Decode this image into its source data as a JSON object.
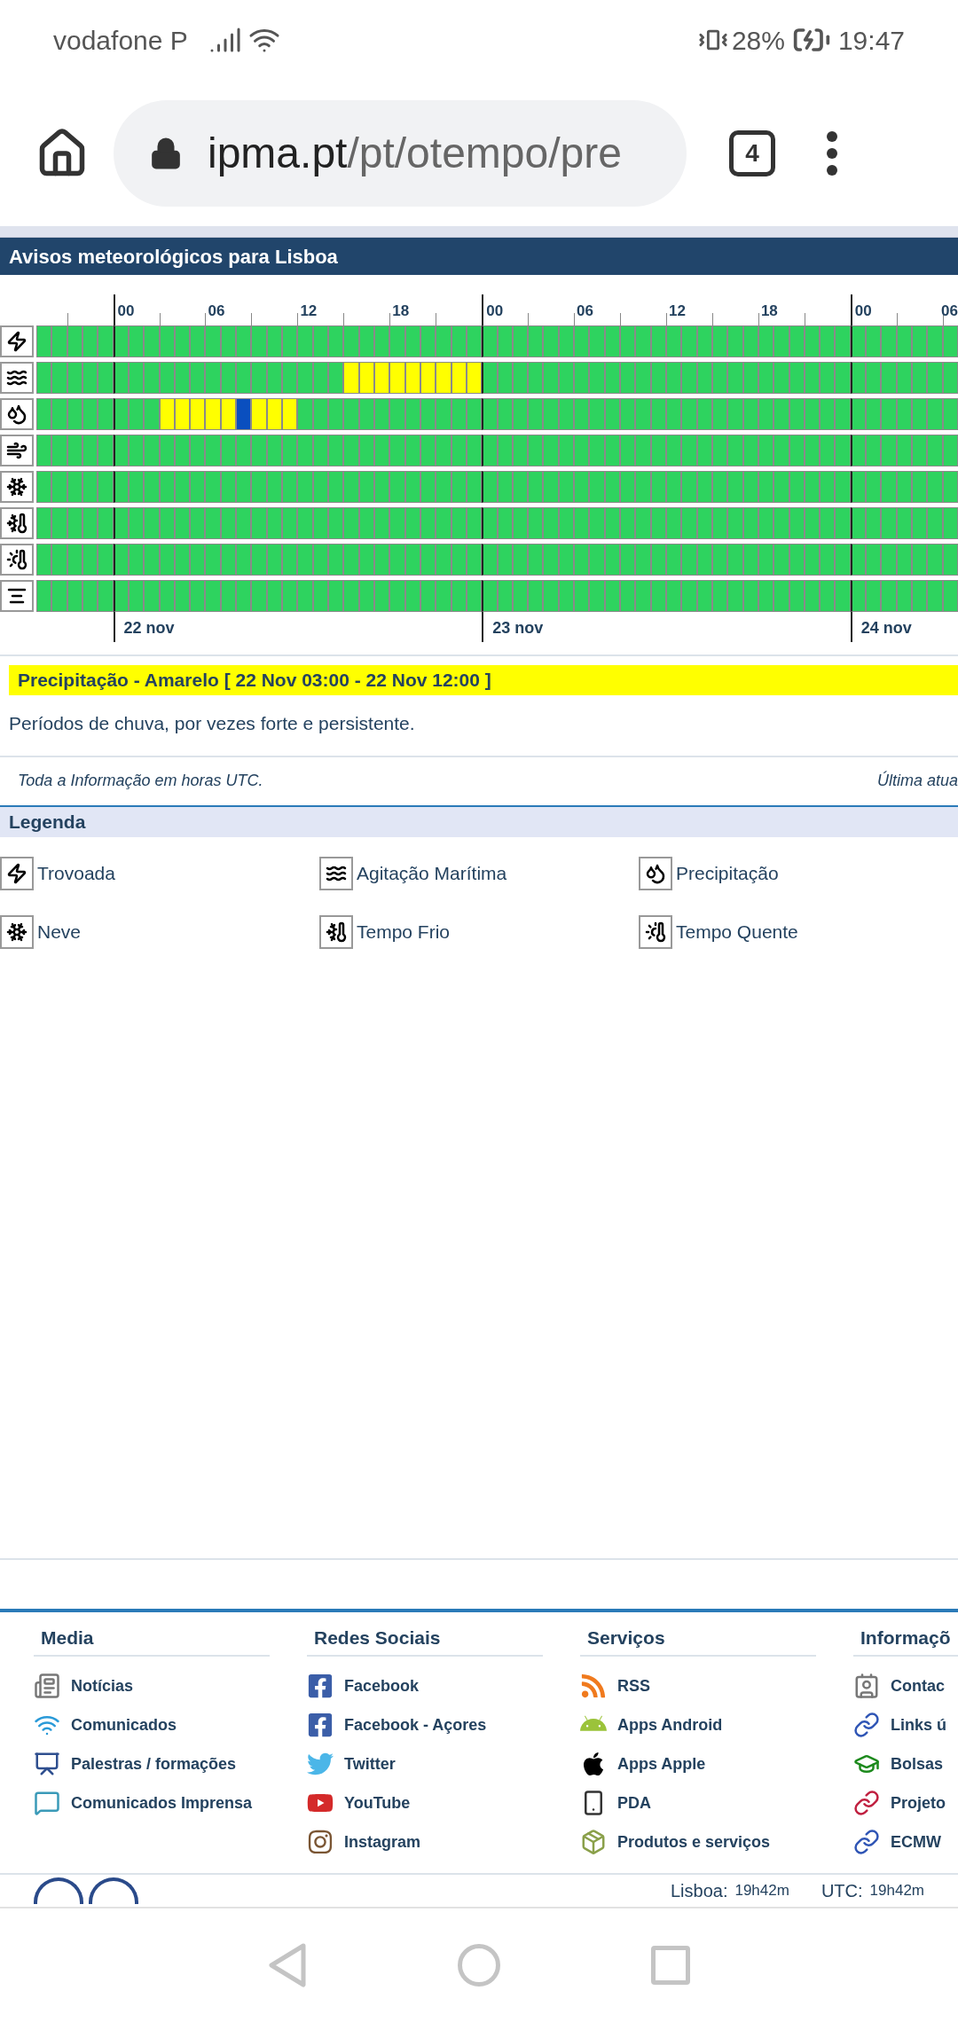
{
  "status_bar": {
    "carrier": "vodafone P",
    "battery": "28%",
    "time": "19:47"
  },
  "browser": {
    "url_host": "ipma.pt",
    "url_path": "/pt/otempo/pre",
    "tab_count": "4"
  },
  "panel": {
    "title": "Avisos meteorológicos para Lisboa",
    "hour_labels": [
      "00",
      "06",
      "12",
      "18",
      "00",
      "06",
      "12",
      "18",
      "00",
      "06"
    ],
    "day_labels": [
      "22 nov",
      "23 nov",
      "24 nov"
    ],
    "rows": [
      {
        "kind": "thunder",
        "cells": [
          {
            "color": "#2ed35f"
          },
          {
            "color": "#2ed35f"
          },
          {
            "color": "#2ed35f"
          },
          {
            "color": "#2ed35f"
          },
          {
            "color": "#2ed35f"
          },
          {
            "color": "#2ed35f"
          },
          {
            "color": "#2ed35f"
          },
          {
            "color": "#2ed35f"
          },
          {
            "color": "#2ed35f"
          },
          {
            "color": "#2ed35f"
          },
          {
            "color": "#2ed35f"
          },
          {
            "color": "#2ed35f"
          },
          {
            "color": "#2ed35f"
          },
          {
            "color": "#2ed35f"
          },
          {
            "color": "#2ed35f"
          },
          {
            "color": "#2ed35f"
          },
          {
            "color": "#2ed35f"
          },
          {
            "color": "#2ed35f"
          },
          {
            "color": "#2ed35f"
          },
          {
            "color": "#2ed35f"
          },
          {
            "color": "#2ed35f"
          },
          {
            "color": "#2ed35f"
          },
          {
            "color": "#2ed35f"
          },
          {
            "color": "#2ed35f"
          },
          {
            "color": "#2ed35f"
          },
          {
            "color": "#2ed35f"
          },
          {
            "color": "#2ed35f"
          },
          {
            "color": "#2ed35f"
          },
          {
            "color": "#2ed35f"
          },
          {
            "color": "#2ed35f"
          },
          {
            "color": "#2ed35f"
          },
          {
            "color": "#2ed35f"
          },
          {
            "color": "#2ed35f"
          },
          {
            "color": "#2ed35f"
          },
          {
            "color": "#2ed35f"
          },
          {
            "color": "#2ed35f"
          },
          {
            "color": "#2ed35f"
          },
          {
            "color": "#2ed35f"
          },
          {
            "color": "#2ed35f"
          },
          {
            "color": "#2ed35f"
          },
          {
            "color": "#2ed35f"
          },
          {
            "color": "#2ed35f"
          },
          {
            "color": "#2ed35f"
          },
          {
            "color": "#2ed35f"
          },
          {
            "color": "#2ed35f"
          },
          {
            "color": "#2ed35f"
          },
          {
            "color": "#2ed35f"
          },
          {
            "color": "#2ed35f"
          },
          {
            "color": "#2ed35f"
          },
          {
            "color": "#2ed35f"
          },
          {
            "color": "#2ed35f"
          },
          {
            "color": "#2ed35f"
          },
          {
            "color": "#2ed35f"
          },
          {
            "color": "#2ed35f"
          },
          {
            "color": "#2ed35f"
          },
          {
            "color": "#2ed35f"
          },
          {
            "color": "#2ed35f"
          },
          {
            "color": "#2ed35f"
          },
          {
            "color": "#2ed35f"
          },
          {
            "color": "#2ed35f"
          }
        ]
      },
      {
        "kind": "sea",
        "cells": [
          {
            "color": "#2ed35f"
          },
          {
            "color": "#2ed35f"
          },
          {
            "color": "#2ed35f"
          },
          {
            "color": "#2ed35f"
          },
          {
            "color": "#2ed35f"
          },
          {
            "color": "#2ed35f"
          },
          {
            "color": "#2ed35f"
          },
          {
            "color": "#2ed35f"
          },
          {
            "color": "#2ed35f"
          },
          {
            "color": "#2ed35f"
          },
          {
            "color": "#2ed35f"
          },
          {
            "color": "#2ed35f"
          },
          {
            "color": "#2ed35f"
          },
          {
            "color": "#2ed35f"
          },
          {
            "color": "#2ed35f"
          },
          {
            "color": "#2ed35f"
          },
          {
            "color": "#2ed35f"
          },
          {
            "color": "#2ed35f"
          },
          {
            "color": "#2ed35f"
          },
          {
            "color": "#2ed35f"
          },
          {
            "color": "#ffff00"
          },
          {
            "color": "#ffff00"
          },
          {
            "color": "#ffff00"
          },
          {
            "color": "#ffff00"
          },
          {
            "color": "#ffff00"
          },
          {
            "color": "#ffff00"
          },
          {
            "color": "#ffff00"
          },
          {
            "color": "#ffff00"
          },
          {
            "color": "#ffff00"
          },
          {
            "color": "#2ed35f"
          },
          {
            "color": "#2ed35f"
          },
          {
            "color": "#2ed35f"
          },
          {
            "color": "#2ed35f"
          },
          {
            "color": "#2ed35f"
          },
          {
            "color": "#2ed35f"
          },
          {
            "color": "#2ed35f"
          },
          {
            "color": "#2ed35f"
          },
          {
            "color": "#2ed35f"
          },
          {
            "color": "#2ed35f"
          },
          {
            "color": "#2ed35f"
          },
          {
            "color": "#2ed35f"
          },
          {
            "color": "#2ed35f"
          },
          {
            "color": "#2ed35f"
          },
          {
            "color": "#2ed35f"
          },
          {
            "color": "#2ed35f"
          },
          {
            "color": "#2ed35f"
          },
          {
            "color": "#2ed35f"
          },
          {
            "color": "#2ed35f"
          },
          {
            "color": "#2ed35f"
          },
          {
            "color": "#2ed35f"
          },
          {
            "color": "#2ed35f"
          },
          {
            "color": "#2ed35f"
          },
          {
            "color": "#2ed35f"
          },
          {
            "color": "#2ed35f"
          },
          {
            "color": "#2ed35f"
          },
          {
            "color": "#2ed35f"
          },
          {
            "color": "#2ed35f"
          },
          {
            "color": "#2ed35f"
          },
          {
            "color": "#2ed35f"
          },
          {
            "color": "#2ed35f"
          }
        ]
      },
      {
        "kind": "rain",
        "cells": [
          {
            "color": "#2ed35f"
          },
          {
            "color": "#2ed35f"
          },
          {
            "color": "#2ed35f"
          },
          {
            "color": "#2ed35f"
          },
          {
            "color": "#2ed35f"
          },
          {
            "color": "#2ed35f"
          },
          {
            "color": "#2ed35f"
          },
          {
            "color": "#2ed35f"
          },
          {
            "color": "#ffff00"
          },
          {
            "color": "#ffff00"
          },
          {
            "color": "#ffff00"
          },
          {
            "color": "#ffff00"
          },
          {
            "color": "#ffff00"
          },
          {
            "color": "#0a4fbf"
          },
          {
            "color": "#ffff00"
          },
          {
            "color": "#ffff00"
          },
          {
            "color": "#ffff00"
          },
          {
            "color": "#2ed35f"
          },
          {
            "color": "#2ed35f"
          },
          {
            "color": "#2ed35f"
          },
          {
            "color": "#2ed35f"
          },
          {
            "color": "#2ed35f"
          },
          {
            "color": "#2ed35f"
          },
          {
            "color": "#2ed35f"
          },
          {
            "color": "#2ed35f"
          },
          {
            "color": "#2ed35f"
          },
          {
            "color": "#2ed35f"
          },
          {
            "color": "#2ed35f"
          },
          {
            "color": "#2ed35f"
          },
          {
            "color": "#2ed35f"
          },
          {
            "color": "#2ed35f"
          },
          {
            "color": "#2ed35f"
          },
          {
            "color": "#2ed35f"
          },
          {
            "color": "#2ed35f"
          },
          {
            "color": "#2ed35f"
          },
          {
            "color": "#2ed35f"
          },
          {
            "color": "#2ed35f"
          },
          {
            "color": "#2ed35f"
          },
          {
            "color": "#2ed35f"
          },
          {
            "color": "#2ed35f"
          },
          {
            "color": "#2ed35f"
          },
          {
            "color": "#2ed35f"
          },
          {
            "color": "#2ed35f"
          },
          {
            "color": "#2ed35f"
          },
          {
            "color": "#2ed35f"
          },
          {
            "color": "#2ed35f"
          },
          {
            "color": "#2ed35f"
          },
          {
            "color": "#2ed35f"
          },
          {
            "color": "#2ed35f"
          },
          {
            "color": "#2ed35f"
          },
          {
            "color": "#2ed35f"
          },
          {
            "color": "#2ed35f"
          },
          {
            "color": "#2ed35f"
          },
          {
            "color": "#2ed35f"
          },
          {
            "color": "#2ed35f"
          },
          {
            "color": "#2ed35f"
          },
          {
            "color": "#2ed35f"
          },
          {
            "color": "#2ed35f"
          },
          {
            "color": "#2ed35f"
          },
          {
            "color": "#2ed35f"
          }
        ]
      },
      {
        "kind": "wind",
        "cells": [
          {
            "color": "#2ed35f"
          },
          {
            "color": "#2ed35f"
          },
          {
            "color": "#2ed35f"
          },
          {
            "color": "#2ed35f"
          },
          {
            "color": "#2ed35f"
          },
          {
            "color": "#2ed35f"
          },
          {
            "color": "#2ed35f"
          },
          {
            "color": "#2ed35f"
          },
          {
            "color": "#2ed35f"
          },
          {
            "color": "#2ed35f"
          },
          {
            "color": "#2ed35f"
          },
          {
            "color": "#2ed35f"
          },
          {
            "color": "#2ed35f"
          },
          {
            "color": "#2ed35f"
          },
          {
            "color": "#2ed35f"
          },
          {
            "color": "#2ed35f"
          },
          {
            "color": "#2ed35f"
          },
          {
            "color": "#2ed35f"
          },
          {
            "color": "#2ed35f"
          },
          {
            "color": "#2ed35f"
          },
          {
            "color": "#2ed35f"
          },
          {
            "color": "#2ed35f"
          },
          {
            "color": "#2ed35f"
          },
          {
            "color": "#2ed35f"
          },
          {
            "color": "#2ed35f"
          },
          {
            "color": "#2ed35f"
          },
          {
            "color": "#2ed35f"
          },
          {
            "color": "#2ed35f"
          },
          {
            "color": "#2ed35f"
          },
          {
            "color": "#2ed35f"
          },
          {
            "color": "#2ed35f"
          },
          {
            "color": "#2ed35f"
          },
          {
            "color": "#2ed35f"
          },
          {
            "color": "#2ed35f"
          },
          {
            "color": "#2ed35f"
          },
          {
            "color": "#2ed35f"
          },
          {
            "color": "#2ed35f"
          },
          {
            "color": "#2ed35f"
          },
          {
            "color": "#2ed35f"
          },
          {
            "color": "#2ed35f"
          },
          {
            "color": "#2ed35f"
          },
          {
            "color": "#2ed35f"
          },
          {
            "color": "#2ed35f"
          },
          {
            "color": "#2ed35f"
          },
          {
            "color": "#2ed35f"
          },
          {
            "color": "#2ed35f"
          },
          {
            "color": "#2ed35f"
          },
          {
            "color": "#2ed35f"
          },
          {
            "color": "#2ed35f"
          },
          {
            "color": "#2ed35f"
          },
          {
            "color": "#2ed35f"
          },
          {
            "color": "#2ed35f"
          },
          {
            "color": "#2ed35f"
          },
          {
            "color": "#2ed35f"
          },
          {
            "color": "#2ed35f"
          },
          {
            "color": "#2ed35f"
          },
          {
            "color": "#2ed35f"
          },
          {
            "color": "#2ed35f"
          },
          {
            "color": "#2ed35f"
          },
          {
            "color": "#2ed35f"
          }
        ]
      },
      {
        "kind": "snow",
        "cells": [
          {
            "color": "#2ed35f"
          },
          {
            "color": "#2ed35f"
          },
          {
            "color": "#2ed35f"
          },
          {
            "color": "#2ed35f"
          },
          {
            "color": "#2ed35f"
          },
          {
            "color": "#2ed35f"
          },
          {
            "color": "#2ed35f"
          },
          {
            "color": "#2ed35f"
          },
          {
            "color": "#2ed35f"
          },
          {
            "color": "#2ed35f"
          },
          {
            "color": "#2ed35f"
          },
          {
            "color": "#2ed35f"
          },
          {
            "color": "#2ed35f"
          },
          {
            "color": "#2ed35f"
          },
          {
            "color": "#2ed35f"
          },
          {
            "color": "#2ed35f"
          },
          {
            "color": "#2ed35f"
          },
          {
            "color": "#2ed35f"
          },
          {
            "color": "#2ed35f"
          },
          {
            "color": "#2ed35f"
          },
          {
            "color": "#2ed35f"
          },
          {
            "color": "#2ed35f"
          },
          {
            "color": "#2ed35f"
          },
          {
            "color": "#2ed35f"
          },
          {
            "color": "#2ed35f"
          },
          {
            "color": "#2ed35f"
          },
          {
            "color": "#2ed35f"
          },
          {
            "color": "#2ed35f"
          },
          {
            "color": "#2ed35f"
          },
          {
            "color": "#2ed35f"
          },
          {
            "color": "#2ed35f"
          },
          {
            "color": "#2ed35f"
          },
          {
            "color": "#2ed35f"
          },
          {
            "color": "#2ed35f"
          },
          {
            "color": "#2ed35f"
          },
          {
            "color": "#2ed35f"
          },
          {
            "color": "#2ed35f"
          },
          {
            "color": "#2ed35f"
          },
          {
            "color": "#2ed35f"
          },
          {
            "color": "#2ed35f"
          },
          {
            "color": "#2ed35f"
          },
          {
            "color": "#2ed35f"
          },
          {
            "color": "#2ed35f"
          },
          {
            "color": "#2ed35f"
          },
          {
            "color": "#2ed35f"
          },
          {
            "color": "#2ed35f"
          },
          {
            "color": "#2ed35f"
          },
          {
            "color": "#2ed35f"
          },
          {
            "color": "#2ed35f"
          },
          {
            "color": "#2ed35f"
          },
          {
            "color": "#2ed35f"
          },
          {
            "color": "#2ed35f"
          },
          {
            "color": "#2ed35f"
          },
          {
            "color": "#2ed35f"
          },
          {
            "color": "#2ed35f"
          },
          {
            "color": "#2ed35f"
          },
          {
            "color": "#2ed35f"
          },
          {
            "color": "#2ed35f"
          },
          {
            "color": "#2ed35f"
          },
          {
            "color": "#2ed35f"
          }
        ]
      },
      {
        "kind": "cold",
        "cells": [
          {
            "color": "#2ed35f"
          },
          {
            "color": "#2ed35f"
          },
          {
            "color": "#2ed35f"
          },
          {
            "color": "#2ed35f"
          },
          {
            "color": "#2ed35f"
          },
          {
            "color": "#2ed35f"
          },
          {
            "color": "#2ed35f"
          },
          {
            "color": "#2ed35f"
          },
          {
            "color": "#2ed35f"
          },
          {
            "color": "#2ed35f"
          },
          {
            "color": "#2ed35f"
          },
          {
            "color": "#2ed35f"
          },
          {
            "color": "#2ed35f"
          },
          {
            "color": "#2ed35f"
          },
          {
            "color": "#2ed35f"
          },
          {
            "color": "#2ed35f"
          },
          {
            "color": "#2ed35f"
          },
          {
            "color": "#2ed35f"
          },
          {
            "color": "#2ed35f"
          },
          {
            "color": "#2ed35f"
          },
          {
            "color": "#2ed35f"
          },
          {
            "color": "#2ed35f"
          },
          {
            "color": "#2ed35f"
          },
          {
            "color": "#2ed35f"
          },
          {
            "color": "#2ed35f"
          },
          {
            "color": "#2ed35f"
          },
          {
            "color": "#2ed35f"
          },
          {
            "color": "#2ed35f"
          },
          {
            "color": "#2ed35f"
          },
          {
            "color": "#2ed35f"
          },
          {
            "color": "#2ed35f"
          },
          {
            "color": "#2ed35f"
          },
          {
            "color": "#2ed35f"
          },
          {
            "color": "#2ed35f"
          },
          {
            "color": "#2ed35f"
          },
          {
            "color": "#2ed35f"
          },
          {
            "color": "#2ed35f"
          },
          {
            "color": "#2ed35f"
          },
          {
            "color": "#2ed35f"
          },
          {
            "color": "#2ed35f"
          },
          {
            "color": "#2ed35f"
          },
          {
            "color": "#2ed35f"
          },
          {
            "color": "#2ed35f"
          },
          {
            "color": "#2ed35f"
          },
          {
            "color": "#2ed35f"
          },
          {
            "color": "#2ed35f"
          },
          {
            "color": "#2ed35f"
          },
          {
            "color": "#2ed35f"
          },
          {
            "color": "#2ed35f"
          },
          {
            "color": "#2ed35f"
          },
          {
            "color": "#2ed35f"
          },
          {
            "color": "#2ed35f"
          },
          {
            "color": "#2ed35f"
          },
          {
            "color": "#2ed35f"
          },
          {
            "color": "#2ed35f"
          },
          {
            "color": "#2ed35f"
          },
          {
            "color": "#2ed35f"
          },
          {
            "color": "#2ed35f"
          },
          {
            "color": "#2ed35f"
          },
          {
            "color": "#2ed35f"
          }
        ]
      },
      {
        "kind": "hot",
        "cells": [
          {
            "color": "#2ed35f"
          },
          {
            "color": "#2ed35f"
          },
          {
            "color": "#2ed35f"
          },
          {
            "color": "#2ed35f"
          },
          {
            "color": "#2ed35f"
          },
          {
            "color": "#2ed35f"
          },
          {
            "color": "#2ed35f"
          },
          {
            "color": "#2ed35f"
          },
          {
            "color": "#2ed35f"
          },
          {
            "color": "#2ed35f"
          },
          {
            "color": "#2ed35f"
          },
          {
            "color": "#2ed35f"
          },
          {
            "color": "#2ed35f"
          },
          {
            "color": "#2ed35f"
          },
          {
            "color": "#2ed35f"
          },
          {
            "color": "#2ed35f"
          },
          {
            "color": "#2ed35f"
          },
          {
            "color": "#2ed35f"
          },
          {
            "color": "#2ed35f"
          },
          {
            "color": "#2ed35f"
          },
          {
            "color": "#2ed35f"
          },
          {
            "color": "#2ed35f"
          },
          {
            "color": "#2ed35f"
          },
          {
            "color": "#2ed35f"
          },
          {
            "color": "#2ed35f"
          },
          {
            "color": "#2ed35f"
          },
          {
            "color": "#2ed35f"
          },
          {
            "color": "#2ed35f"
          },
          {
            "color": "#2ed35f"
          },
          {
            "color": "#2ed35f"
          },
          {
            "color": "#2ed35f"
          },
          {
            "color": "#2ed35f"
          },
          {
            "color": "#2ed35f"
          },
          {
            "color": "#2ed35f"
          },
          {
            "color": "#2ed35f"
          },
          {
            "color": "#2ed35f"
          },
          {
            "color": "#2ed35f"
          },
          {
            "color": "#2ed35f"
          },
          {
            "color": "#2ed35f"
          },
          {
            "color": "#2ed35f"
          },
          {
            "color": "#2ed35f"
          },
          {
            "color": "#2ed35f"
          },
          {
            "color": "#2ed35f"
          },
          {
            "color": "#2ed35f"
          },
          {
            "color": "#2ed35f"
          },
          {
            "color": "#2ed35f"
          },
          {
            "color": "#2ed35f"
          },
          {
            "color": "#2ed35f"
          },
          {
            "color": "#2ed35f"
          },
          {
            "color": "#2ed35f"
          },
          {
            "color": "#2ed35f"
          },
          {
            "color": "#2ed35f"
          },
          {
            "color": "#2ed35f"
          },
          {
            "color": "#2ed35f"
          },
          {
            "color": "#2ed35f"
          },
          {
            "color": "#2ed35f"
          },
          {
            "color": "#2ed35f"
          },
          {
            "color": "#2ed35f"
          },
          {
            "color": "#2ed35f"
          },
          {
            "color": "#2ed35f"
          }
        ]
      },
      {
        "kind": "fog",
        "cells": [
          {
            "color": "#2ed35f"
          },
          {
            "color": "#2ed35f"
          },
          {
            "color": "#2ed35f"
          },
          {
            "color": "#2ed35f"
          },
          {
            "color": "#2ed35f"
          },
          {
            "color": "#2ed35f"
          },
          {
            "color": "#2ed35f"
          },
          {
            "color": "#2ed35f"
          },
          {
            "color": "#2ed35f"
          },
          {
            "color": "#2ed35f"
          },
          {
            "color": "#2ed35f"
          },
          {
            "color": "#2ed35f"
          },
          {
            "color": "#2ed35f"
          },
          {
            "color": "#2ed35f"
          },
          {
            "color": "#2ed35f"
          },
          {
            "color": "#2ed35f"
          },
          {
            "color": "#2ed35f"
          },
          {
            "color": "#2ed35f"
          },
          {
            "color": "#2ed35f"
          },
          {
            "color": "#2ed35f"
          },
          {
            "color": "#2ed35f"
          },
          {
            "color": "#2ed35f"
          },
          {
            "color": "#2ed35f"
          },
          {
            "color": "#2ed35f"
          },
          {
            "color": "#2ed35f"
          },
          {
            "color": "#2ed35f"
          },
          {
            "color": "#2ed35f"
          },
          {
            "color": "#2ed35f"
          },
          {
            "color": "#2ed35f"
          },
          {
            "color": "#2ed35f"
          },
          {
            "color": "#2ed35f"
          },
          {
            "color": "#2ed35f"
          },
          {
            "color": "#2ed35f"
          },
          {
            "color": "#2ed35f"
          },
          {
            "color": "#2ed35f"
          },
          {
            "color": "#2ed35f"
          },
          {
            "color": "#2ed35f"
          },
          {
            "color": "#2ed35f"
          },
          {
            "color": "#2ed35f"
          },
          {
            "color": "#2ed35f"
          },
          {
            "color": "#2ed35f"
          },
          {
            "color": "#2ed35f"
          },
          {
            "color": "#2ed35f"
          },
          {
            "color": "#2ed35f"
          },
          {
            "color": "#2ed35f"
          },
          {
            "color": "#2ed35f"
          },
          {
            "color": "#2ed35f"
          },
          {
            "color": "#2ed35f"
          },
          {
            "color": "#2ed35f"
          },
          {
            "color": "#2ed35f"
          },
          {
            "color": "#2ed35f"
          },
          {
            "color": "#2ed35f"
          },
          {
            "color": "#2ed35f"
          },
          {
            "color": "#2ed35f"
          },
          {
            "color": "#2ed35f"
          },
          {
            "color": "#2ed35f"
          },
          {
            "color": "#2ed35f"
          },
          {
            "color": "#2ed35f"
          },
          {
            "color": "#2ed35f"
          },
          {
            "color": "#2ed35f"
          }
        ]
      }
    ]
  },
  "warning": {
    "title": "Precipitação - Amarelo [ 22 Nov 03:00 - 22 Nov 12:00 ]",
    "description": "Períodos de chuva, por vezes forte e persistente."
  },
  "note": {
    "text": "Toda a Informação em horas UTC.",
    "last_update": "Última atua"
  },
  "legend": {
    "title": "Legenda",
    "items": [
      {
        "kind": "thunder",
        "label": "Trovoada"
      },
      {
        "kind": "sea",
        "label": "Agitação Marítima"
      },
      {
        "kind": "rain",
        "label": "Precipitação"
      },
      {
        "kind": "snow",
        "label": "Neve"
      },
      {
        "kind": "cold",
        "label": "Tempo Frio"
      },
      {
        "kind": "hot",
        "label": "Tempo Quente"
      }
    ]
  },
  "footer": {
    "columns": [
      {
        "title": "Media",
        "links": [
          {
            "kind": "news",
            "label": "Notícias"
          },
          {
            "kind": "wifi",
            "label": "Comunicados"
          },
          {
            "kind": "board",
            "label": "Palestras / formações"
          },
          {
            "kind": "chat",
            "label": "Comunicados Imprensa"
          }
        ]
      },
      {
        "title": "Redes Sociais",
        "links": [
          {
            "kind": "facebook",
            "label": "Facebook"
          },
          {
            "kind": "facebook",
            "label": "Facebook - Açores"
          },
          {
            "kind": "twitter",
            "label": "Twitter"
          },
          {
            "kind": "youtube",
            "label": "YouTube"
          },
          {
            "kind": "instagram",
            "label": "Instagram"
          }
        ]
      },
      {
        "title": "Serviços",
        "links": [
          {
            "kind": "rss",
            "label": "RSS"
          },
          {
            "kind": "android",
            "label": "Apps Android"
          },
          {
            "kind": "apple",
            "label": "Apps Apple"
          },
          {
            "kind": "phone",
            "label": "PDA"
          },
          {
            "kind": "products",
            "label": "Produtos e serviços"
          }
        ]
      },
      {
        "title": "Informaçõ",
        "links": [
          {
            "kind": "contacts",
            "label": "Contac"
          },
          {
            "kind": "link",
            "label": "Links ú"
          },
          {
            "kind": "grad",
            "label": "Bolsas"
          },
          {
            "kind": "project",
            "label": "Projeto"
          },
          {
            "kind": "link",
            "label": "ECMW"
          }
        ]
      }
    ]
  },
  "clock": [
    {
      "label": "Lisboa:",
      "value": "19h42m"
    },
    {
      "label": "UTC:",
      "value": "19h42m"
    }
  ]
}
